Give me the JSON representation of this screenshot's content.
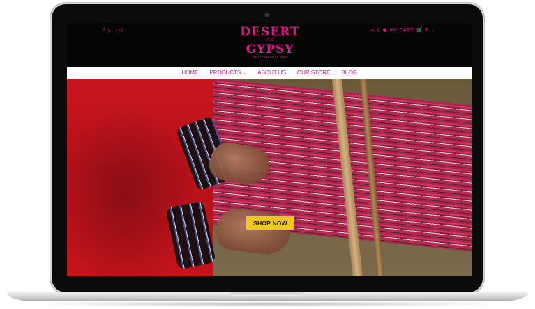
{
  "header": {
    "social_icons": [
      "facebook-icon",
      "twitter-icon",
      "pinterest-icon",
      "instagram-icon"
    ],
    "social_glyphs": [
      "f",
      "y",
      "p",
      "◎"
    ],
    "utility": {
      "home_glyph": "⌂",
      "search_glyph": "⚲",
      "user_glyph": "●",
      "cart_label": "MY CART",
      "cart_glyph": "🛒",
      "cart_count": "0",
      "chevron_glyph": "⌄"
    },
    "logo": {
      "line1": "DESERT",
      "line2": "THE",
      "line3": "GYPSY",
      "tagline": "MEXICAN FOLK ART"
    }
  },
  "nav": {
    "items": [
      {
        "label": "HOME"
      },
      {
        "label": "PRODUCTS",
        "has_dropdown": true,
        "chevron": "⌄"
      },
      {
        "label": "ABOUT US"
      },
      {
        "label": "OUR STORE"
      },
      {
        "label": "BLOG"
      }
    ]
  },
  "hero": {
    "cta_label": "SHOP NOW",
    "accent_color": "#e0178a",
    "cta_color": "#f0c81a"
  }
}
